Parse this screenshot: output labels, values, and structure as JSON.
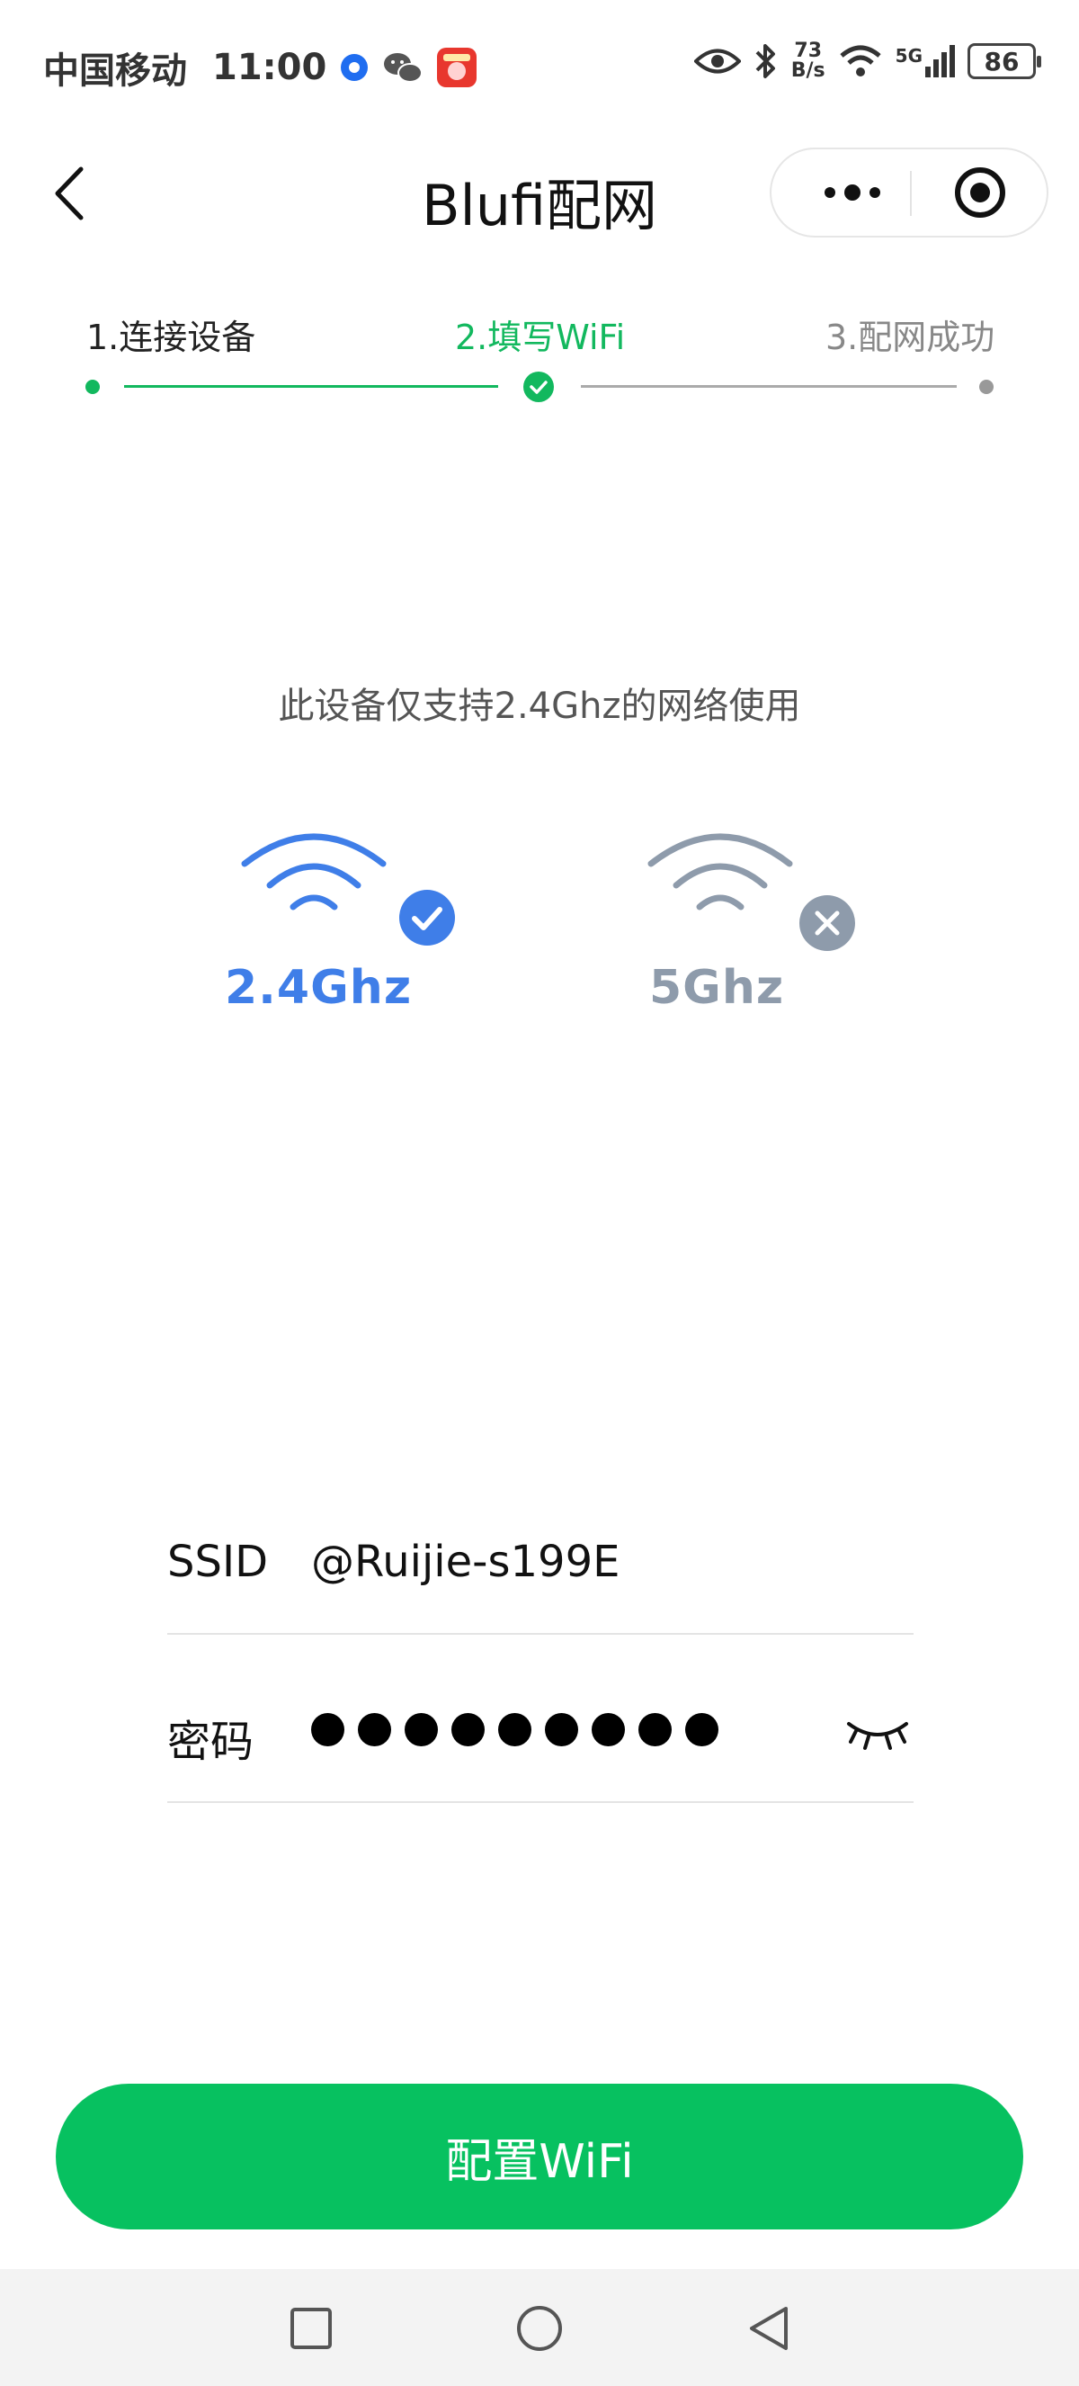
{
  "status_bar": {
    "carrier": "中国移动",
    "time": "11:00",
    "net_speed_value": "73",
    "net_speed_unit": "B/s",
    "network_type": "5G",
    "battery": "86"
  },
  "nav": {
    "title": "Blufi配网"
  },
  "steps": [
    {
      "label": "1.连接设备",
      "state": "done"
    },
    {
      "label": "2.填写WiFi",
      "state": "current"
    },
    {
      "label": "3.配网成功",
      "state": "pending"
    }
  ],
  "notice": "此设备仅支持2.4Ghz的网络使用",
  "bands": [
    {
      "label": "2.4Ghz",
      "supported": true,
      "color": "#3f7ee8"
    },
    {
      "label": "5Ghz",
      "supported": false,
      "color": "#8e9bab"
    }
  ],
  "form": {
    "ssid_label": "SSID",
    "ssid_value": "@Ruijie-s199E",
    "password_label": "密码",
    "password_mask": "●●●●●●●●●"
  },
  "primary_button": "配置WiFi",
  "colors": {
    "accent": "#07c160",
    "step_active": "#12b85e",
    "band_ok": "#3f7ee8",
    "band_no": "#8e9bab"
  }
}
